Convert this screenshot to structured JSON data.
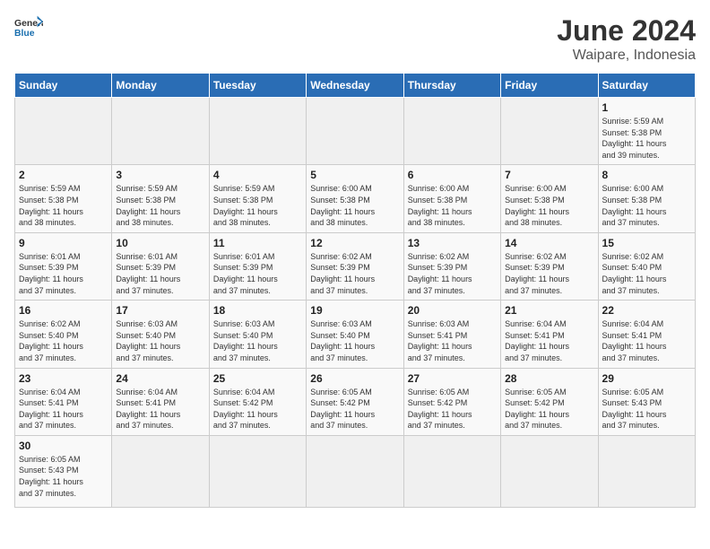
{
  "header": {
    "logo_general": "General",
    "logo_blue": "Blue",
    "title": "June 2024",
    "subtitle": "Waipare, Indonesia"
  },
  "days_of_week": [
    "Sunday",
    "Monday",
    "Tuesday",
    "Wednesday",
    "Thursday",
    "Friday",
    "Saturday"
  ],
  "weeks": [
    {
      "days": [
        {
          "num": "",
          "info": ""
        },
        {
          "num": "",
          "info": ""
        },
        {
          "num": "",
          "info": ""
        },
        {
          "num": "",
          "info": ""
        },
        {
          "num": "",
          "info": ""
        },
        {
          "num": "",
          "info": ""
        },
        {
          "num": "1",
          "info": "Sunrise: 5:59 AM\nSunset: 5:38 PM\nDaylight: 11 hours\nand 39 minutes."
        }
      ]
    },
    {
      "days": [
        {
          "num": "2",
          "info": "Sunrise: 5:59 AM\nSunset: 5:38 PM\nDaylight: 11 hours\nand 38 minutes."
        },
        {
          "num": "3",
          "info": "Sunrise: 5:59 AM\nSunset: 5:38 PM\nDaylight: 11 hours\nand 38 minutes."
        },
        {
          "num": "4",
          "info": "Sunrise: 5:59 AM\nSunset: 5:38 PM\nDaylight: 11 hours\nand 38 minutes."
        },
        {
          "num": "5",
          "info": "Sunrise: 6:00 AM\nSunset: 5:38 PM\nDaylight: 11 hours\nand 38 minutes."
        },
        {
          "num": "6",
          "info": "Sunrise: 6:00 AM\nSunset: 5:38 PM\nDaylight: 11 hours\nand 38 minutes."
        },
        {
          "num": "7",
          "info": "Sunrise: 6:00 AM\nSunset: 5:38 PM\nDaylight: 11 hours\nand 38 minutes."
        },
        {
          "num": "8",
          "info": "Sunrise: 6:00 AM\nSunset: 5:38 PM\nDaylight: 11 hours\nand 37 minutes."
        }
      ]
    },
    {
      "days": [
        {
          "num": "9",
          "info": "Sunrise: 6:01 AM\nSunset: 5:39 PM\nDaylight: 11 hours\nand 37 minutes."
        },
        {
          "num": "10",
          "info": "Sunrise: 6:01 AM\nSunset: 5:39 PM\nDaylight: 11 hours\nand 37 minutes."
        },
        {
          "num": "11",
          "info": "Sunrise: 6:01 AM\nSunset: 5:39 PM\nDaylight: 11 hours\nand 37 minutes."
        },
        {
          "num": "12",
          "info": "Sunrise: 6:02 AM\nSunset: 5:39 PM\nDaylight: 11 hours\nand 37 minutes."
        },
        {
          "num": "13",
          "info": "Sunrise: 6:02 AM\nSunset: 5:39 PM\nDaylight: 11 hours\nand 37 minutes."
        },
        {
          "num": "14",
          "info": "Sunrise: 6:02 AM\nSunset: 5:39 PM\nDaylight: 11 hours\nand 37 minutes."
        },
        {
          "num": "15",
          "info": "Sunrise: 6:02 AM\nSunset: 5:40 PM\nDaylight: 11 hours\nand 37 minutes."
        }
      ]
    },
    {
      "days": [
        {
          "num": "16",
          "info": "Sunrise: 6:02 AM\nSunset: 5:40 PM\nDaylight: 11 hours\nand 37 minutes."
        },
        {
          "num": "17",
          "info": "Sunrise: 6:03 AM\nSunset: 5:40 PM\nDaylight: 11 hours\nand 37 minutes."
        },
        {
          "num": "18",
          "info": "Sunrise: 6:03 AM\nSunset: 5:40 PM\nDaylight: 11 hours\nand 37 minutes."
        },
        {
          "num": "19",
          "info": "Sunrise: 6:03 AM\nSunset: 5:40 PM\nDaylight: 11 hours\nand 37 minutes."
        },
        {
          "num": "20",
          "info": "Sunrise: 6:03 AM\nSunset: 5:41 PM\nDaylight: 11 hours\nand 37 minutes."
        },
        {
          "num": "21",
          "info": "Sunrise: 6:04 AM\nSunset: 5:41 PM\nDaylight: 11 hours\nand 37 minutes."
        },
        {
          "num": "22",
          "info": "Sunrise: 6:04 AM\nSunset: 5:41 PM\nDaylight: 11 hours\nand 37 minutes."
        }
      ]
    },
    {
      "days": [
        {
          "num": "23",
          "info": "Sunrise: 6:04 AM\nSunset: 5:41 PM\nDaylight: 11 hours\nand 37 minutes."
        },
        {
          "num": "24",
          "info": "Sunrise: 6:04 AM\nSunset: 5:41 PM\nDaylight: 11 hours\nand 37 minutes."
        },
        {
          "num": "25",
          "info": "Sunrise: 6:04 AM\nSunset: 5:42 PM\nDaylight: 11 hours\nand 37 minutes."
        },
        {
          "num": "26",
          "info": "Sunrise: 6:05 AM\nSunset: 5:42 PM\nDaylight: 11 hours\nand 37 minutes."
        },
        {
          "num": "27",
          "info": "Sunrise: 6:05 AM\nSunset: 5:42 PM\nDaylight: 11 hours\nand 37 minutes."
        },
        {
          "num": "28",
          "info": "Sunrise: 6:05 AM\nSunset: 5:42 PM\nDaylight: 11 hours\nand 37 minutes."
        },
        {
          "num": "29",
          "info": "Sunrise: 6:05 AM\nSunset: 5:43 PM\nDaylight: 11 hours\nand 37 minutes."
        }
      ]
    },
    {
      "days": [
        {
          "num": "30",
          "info": "Sunrise: 6:05 AM\nSunset: 5:43 PM\nDaylight: 11 hours\nand 37 minutes."
        },
        {
          "num": "",
          "info": ""
        },
        {
          "num": "",
          "info": ""
        },
        {
          "num": "",
          "info": ""
        },
        {
          "num": "",
          "info": ""
        },
        {
          "num": "",
          "info": ""
        },
        {
          "num": "",
          "info": ""
        }
      ]
    }
  ]
}
